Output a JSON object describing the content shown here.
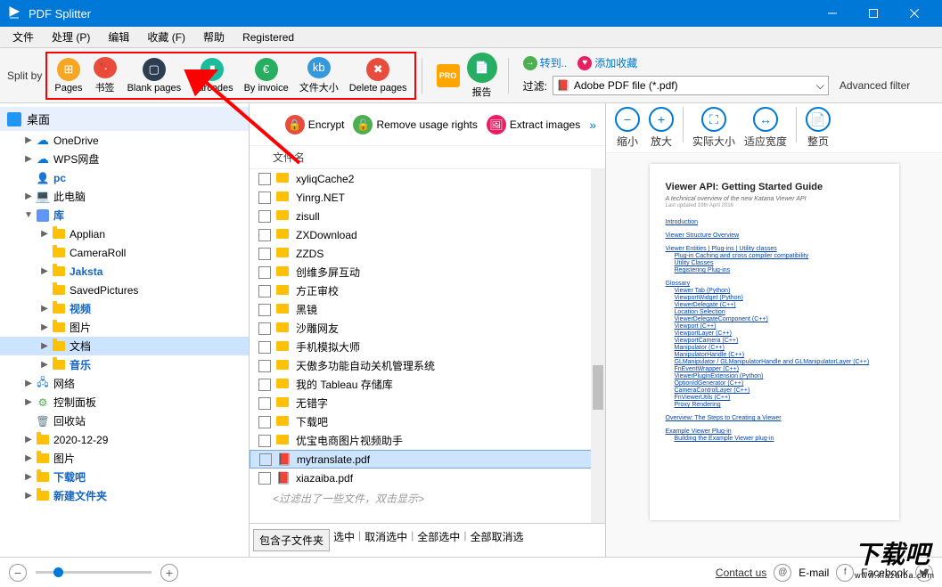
{
  "window": {
    "title": "PDF Splitter"
  },
  "menu": {
    "items": [
      "文件",
      "处理 (P)",
      "编辑",
      "收藏 (F)",
      "帮助",
      "Registered"
    ]
  },
  "toolbar": {
    "split_by_label": "Split by",
    "buttons": [
      {
        "label": "Pages",
        "color": "#f5a623"
      },
      {
        "label": "书签",
        "color": "#e74c3c"
      },
      {
        "label": "Blank pages",
        "color": "#2c3e50"
      },
      {
        "label": "Barcodes",
        "color": "#1abc9c"
      },
      {
        "label": "By invoice",
        "color": "#27ae60"
      },
      {
        "label": "文件大小",
        "color": "#3498db"
      },
      {
        "label": "Delete pages",
        "color": "#e74c3c"
      }
    ],
    "pro": "PRO",
    "report": "报告",
    "go_label": "转到..",
    "fav_label": "添加收藏",
    "filter_label": "过滤:",
    "filter_value": "Adobe PDF file (*.pdf)",
    "advanced": "Advanced filter"
  },
  "tree": {
    "root": "桌面",
    "items": [
      {
        "depth": 1,
        "arrow": "▶",
        "icon": "cloud",
        "label": "OneDrive",
        "cls": ""
      },
      {
        "depth": 1,
        "arrow": "▶",
        "icon": "cloud",
        "label": "WPS网盘",
        "cls": ""
      },
      {
        "depth": 1,
        "arrow": "",
        "icon": "user",
        "label": "pc",
        "cls": "blue-b"
      },
      {
        "depth": 1,
        "arrow": "▶",
        "icon": "pc",
        "label": "此电脑",
        "cls": ""
      },
      {
        "depth": 1,
        "arrow": "▼",
        "icon": "lib",
        "label": "库",
        "cls": "blue-b"
      },
      {
        "depth": 2,
        "arrow": "▶",
        "icon": "folder",
        "label": "Applian",
        "cls": ""
      },
      {
        "depth": 2,
        "arrow": "",
        "icon": "folder",
        "label": "CameraRoll",
        "cls": ""
      },
      {
        "depth": 2,
        "arrow": "▶",
        "icon": "folder",
        "label": "Jaksta",
        "cls": "blue-b"
      },
      {
        "depth": 2,
        "arrow": "",
        "icon": "folder",
        "label": "SavedPictures",
        "cls": ""
      },
      {
        "depth": 2,
        "arrow": "▶",
        "icon": "folder",
        "label": "视频",
        "cls": "blue-b"
      },
      {
        "depth": 2,
        "arrow": "▶",
        "icon": "folder",
        "label": "图片",
        "cls": ""
      },
      {
        "depth": 2,
        "arrow": "▶",
        "icon": "folder",
        "label": "文档",
        "cls": "",
        "selected": true
      },
      {
        "depth": 2,
        "arrow": "▶",
        "icon": "folder",
        "label": "音乐",
        "cls": "blue-b"
      },
      {
        "depth": 1,
        "arrow": "▶",
        "icon": "net",
        "label": "网络",
        "cls": ""
      },
      {
        "depth": 1,
        "arrow": "▶",
        "icon": "panel",
        "label": "控制面板",
        "cls": ""
      },
      {
        "depth": 1,
        "arrow": "",
        "icon": "trash",
        "label": "回收站",
        "cls": ""
      },
      {
        "depth": 1,
        "arrow": "▶",
        "icon": "folder",
        "label": "2020-12-29",
        "cls": ""
      },
      {
        "depth": 1,
        "arrow": "▶",
        "icon": "folder",
        "label": "图片",
        "cls": ""
      },
      {
        "depth": 1,
        "arrow": "▶",
        "icon": "folder",
        "label": "下载吧",
        "cls": "blue-b"
      },
      {
        "depth": 1,
        "arrow": "▶",
        "icon": "folder",
        "label": "新建文件夹",
        "cls": "blue-b"
      }
    ]
  },
  "middle": {
    "tools": {
      "encrypt": "Encrypt",
      "remove": "Remove usage rights",
      "extract": "Extract images"
    },
    "column": "文件名",
    "files": [
      {
        "type": "folder",
        "name": "xyliqCache2"
      },
      {
        "type": "folder",
        "name": "Yinrg.NET"
      },
      {
        "type": "folder",
        "name": "zisull"
      },
      {
        "type": "folder",
        "name": "ZXDownload"
      },
      {
        "type": "folder",
        "name": "ZZDS"
      },
      {
        "type": "folder",
        "name": "创维多屏互动"
      },
      {
        "type": "folder",
        "name": "方正审校"
      },
      {
        "type": "folder",
        "name": "黑镜"
      },
      {
        "type": "folder",
        "name": "沙雕网友"
      },
      {
        "type": "folder",
        "name": "手机模拟大师"
      },
      {
        "type": "folder",
        "name": "天傲多功能自动关机管理系统"
      },
      {
        "type": "folder",
        "name": "我的 Tableau 存储库"
      },
      {
        "type": "folder",
        "name": "无错字"
      },
      {
        "type": "folder",
        "name": "下载吧"
      },
      {
        "type": "folder",
        "name": "优宝电商图片视频助手"
      },
      {
        "type": "pdf",
        "name": "mytranslate.pdf",
        "selected": true
      },
      {
        "type": "pdf",
        "name": "xiazaiba.pdf"
      }
    ],
    "filtered_msg": "<过滤出了一些文件，双击显示>",
    "footer": [
      "包含子文件夹",
      "选中",
      "取消选中",
      "全部选中",
      "全部取消选"
    ]
  },
  "viewer": {
    "tools": [
      "缩小",
      "放大",
      "实际大小",
      "适应宽度",
      "整页"
    ],
    "doc": {
      "title": "Viewer API: Getting Started Guide",
      "sub": "A technical overview of the new Katana Viewer API",
      "date": "Last updated 19th April 2016",
      "links": [
        {
          "t": "Introduction",
          "i": 0
        },
        {
          "t": "Viewer Structure Overview",
          "i": 0
        },
        {
          "t": "Viewer Entities | Plug-ins | Utility classes",
          "i": 0
        },
        {
          "t": "Plug-in Caching and cross compiler compatibility",
          "i": 1
        },
        {
          "t": "Utility Classes",
          "i": 1
        },
        {
          "t": "Registering Plug-ins",
          "i": 1
        },
        {
          "t": "Glossary",
          "i": 0
        },
        {
          "t": "Viewer Tab (Python)",
          "i": 1
        },
        {
          "t": "ViewportWidget (Python)",
          "i": 1
        },
        {
          "t": "ViewerDelegate (C++)",
          "i": 1
        },
        {
          "t": "Location Selection",
          "i": 1
        },
        {
          "t": "ViewerDelegateComponent (C++)",
          "i": 1
        },
        {
          "t": "Viewport (C++)",
          "i": 1
        },
        {
          "t": "ViewportLayer (C++)",
          "i": 1
        },
        {
          "t": "ViewportCamera (C++)",
          "i": 1
        },
        {
          "t": "Manipulator (C++)",
          "i": 1
        },
        {
          "t": "ManipulatorHandle (C++)",
          "i": 1
        },
        {
          "t": "GLManipulator / GLManipulatorHandle and GLManipulatorLayer (C++)",
          "i": 1
        },
        {
          "t": "FnEventWrapper (C++)",
          "i": 1
        },
        {
          "t": "ViewerPluginExtension (Python)",
          "i": 1
        },
        {
          "t": "OptionIdGenerator (C++)",
          "i": 1
        },
        {
          "t": "CameraControlLayer (C++)",
          "i": 1
        },
        {
          "t": "FnViewerUtils (C++)",
          "i": 1
        },
        {
          "t": "Proxy Rendering",
          "i": 1
        },
        {
          "t": "Overview: The Steps to Creating a Viewer",
          "i": 0
        },
        {
          "t": "Example Viewer Plug-in",
          "i": 0
        },
        {
          "t": "Building the Example Viewer plug-in",
          "i": 1
        }
      ]
    }
  },
  "footer": {
    "contact": "Contact us",
    "email": "E-mail",
    "fb": "Facebook"
  },
  "watermark": {
    "main": "下载吧",
    "sub": "www.xiazaiba.com"
  }
}
